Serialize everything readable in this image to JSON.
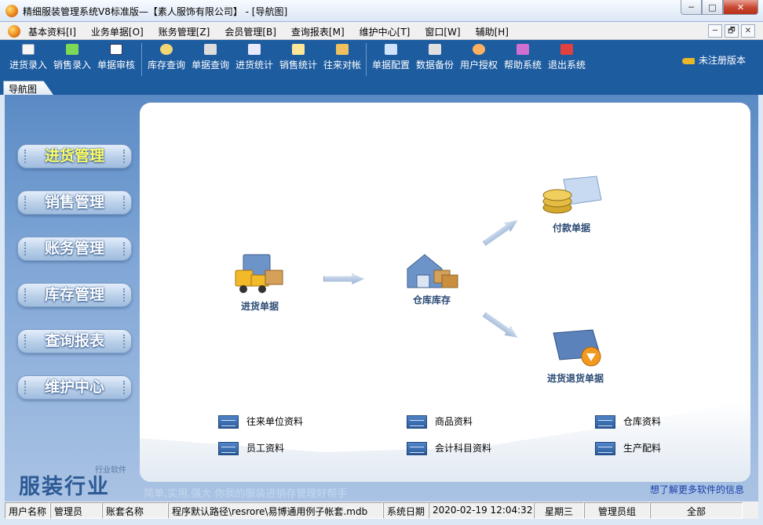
{
  "window": {
    "title": "精细服装管理系统V8标准版—【素人服饰有限公司】 - [导航图]",
    "buttons": [
      "─",
      "□",
      "✕"
    ]
  },
  "menu": {
    "items": [
      "基本资料[I]",
      "业务单据[O]",
      "账务管理[Z]",
      "会员管理[B]",
      "查询报表[M]",
      "维护中心[T]",
      "窗口[W]",
      "辅助[H]"
    ],
    "mdi_buttons": [
      "─",
      "🗗",
      "✕"
    ]
  },
  "toolbar": {
    "group1": [
      {
        "label": "进货录入",
        "icon": "save-icon",
        "color": "#f5f5f5"
      },
      {
        "label": "销售录入",
        "icon": "sales-entry-icon",
        "color": "#7ed957"
      },
      {
        "label": "单据审核",
        "icon": "checkbox-icon",
        "color": "#ffffff"
      }
    ],
    "group2": [
      {
        "label": "库存查询",
        "icon": "magnifier-icon",
        "color": "#f2d675"
      },
      {
        "label": "单据查询",
        "icon": "document-search-icon",
        "color": "#dddddd"
      },
      {
        "label": "进货统计",
        "icon": "purchase-stats-icon",
        "color": "#e8e8ff"
      },
      {
        "label": "销售统计",
        "icon": "sales-stats-icon",
        "color": "#ffe79a"
      },
      {
        "label": "往来对帐",
        "icon": "reconcile-icon",
        "color": "#f0c060"
      }
    ],
    "group3": [
      {
        "label": "单据配置",
        "icon": "config-icon",
        "color": "#cfe3ff"
      },
      {
        "label": "数据备份",
        "icon": "backup-icon",
        "color": "#e0e0e0"
      },
      {
        "label": "用户授权",
        "icon": "user-auth-icon",
        "color": "#ffb060"
      },
      {
        "label": "帮助系统",
        "icon": "help-book-icon",
        "color": "#d070d0"
      },
      {
        "label": "退出系统",
        "icon": "exit-icon",
        "color": "#e04040"
      }
    ],
    "registration": "未注册版本"
  },
  "tab": {
    "label": "导航图"
  },
  "nav": [
    {
      "label": "进货管理",
      "active": true
    },
    {
      "label": "销售管理",
      "active": false
    },
    {
      "label": "账务管理",
      "active": false
    },
    {
      "label": "库存管理",
      "active": false
    },
    {
      "label": "查询报表",
      "active": false
    },
    {
      "label": "维护中心",
      "active": false
    }
  ],
  "flow": {
    "purchase": "进货单据",
    "warehouse": "仓库库存",
    "payment": "付款单据",
    "return": "进货退货单据"
  },
  "resources": [
    "往来单位资料",
    "商品资料",
    "仓库资料",
    "员工资料",
    "会计科目资料",
    "生产配料"
  ],
  "branding": {
    "name": "服装行业",
    "small": "行业软件",
    "slogan": "简单,实用,强大 你我的服装进销存管理好帮手",
    "more_info": "想了解更多软件的信息"
  },
  "status": [
    {
      "text": "用户名称",
      "w": 58
    },
    {
      "text": "管理员",
      "w": 66
    },
    {
      "text": "账套名称",
      "w": 84
    },
    {
      "text": "程序默认路径\\resrore\\易博通用例子帐套.mdb",
      "w": 274
    },
    {
      "text": "系统日期",
      "w": 58
    },
    {
      "text": "2020-02-19  12:04:32",
      "w": 134
    },
    {
      "text": "星期三",
      "w": 64
    },
    {
      "text": "管理员组",
      "w": 84
    },
    {
      "text": "全部",
      "w": 118
    }
  ]
}
